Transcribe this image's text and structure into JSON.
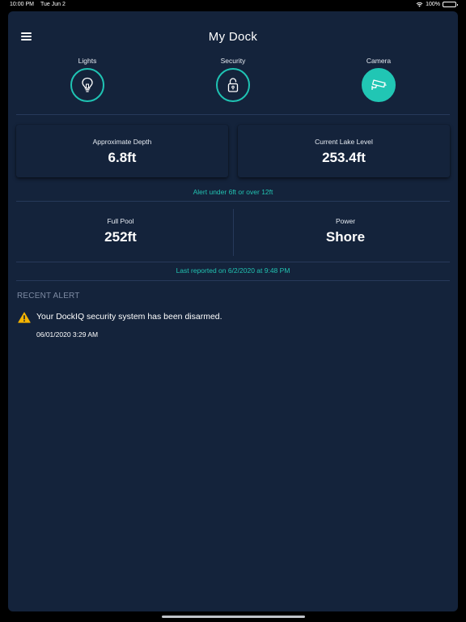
{
  "status_bar": {
    "time": "10:00 PM",
    "date": "Tue Jun 2",
    "battery": "100%",
    "wifi_icon": "wifi-icon",
    "battery_icon": "battery-icon"
  },
  "nav": {
    "title": "My Dock",
    "menu_icon": "hamburger-menu-icon"
  },
  "controls": [
    {
      "label": "Lights",
      "icon": "lightbulb-icon",
      "active": false
    },
    {
      "label": "Security",
      "icon": "unlocked-padlock-icon",
      "active": false
    },
    {
      "label": "Camera",
      "icon": "security-camera-icon",
      "active": true
    }
  ],
  "metrics": {
    "depth": {
      "label": "Approximate Depth",
      "value": "6.8ft"
    },
    "lake_level": {
      "label": "Current Lake Level",
      "value": "253.4ft"
    }
  },
  "alert_threshold": "Alert under 6ft or over 12ft",
  "stats": {
    "full_pool": {
      "label": "Full Pool",
      "value": "252ft"
    },
    "power": {
      "label": "Power",
      "value": "Shore"
    }
  },
  "last_reported": "Last reported on 6/2/2020 at 9:48 PM",
  "recent_alert": {
    "heading": "RECENT ALERT",
    "icon": "warning-icon",
    "message": "Your DockIQ security system has been disarmed.",
    "timestamp": "06/01/2020 3:29 AM"
  },
  "colors": {
    "background": "#14233b",
    "accent": "#21c6b4",
    "text": "#ffffff",
    "muted": "#7e8ba3",
    "warning": "#f5b400"
  }
}
